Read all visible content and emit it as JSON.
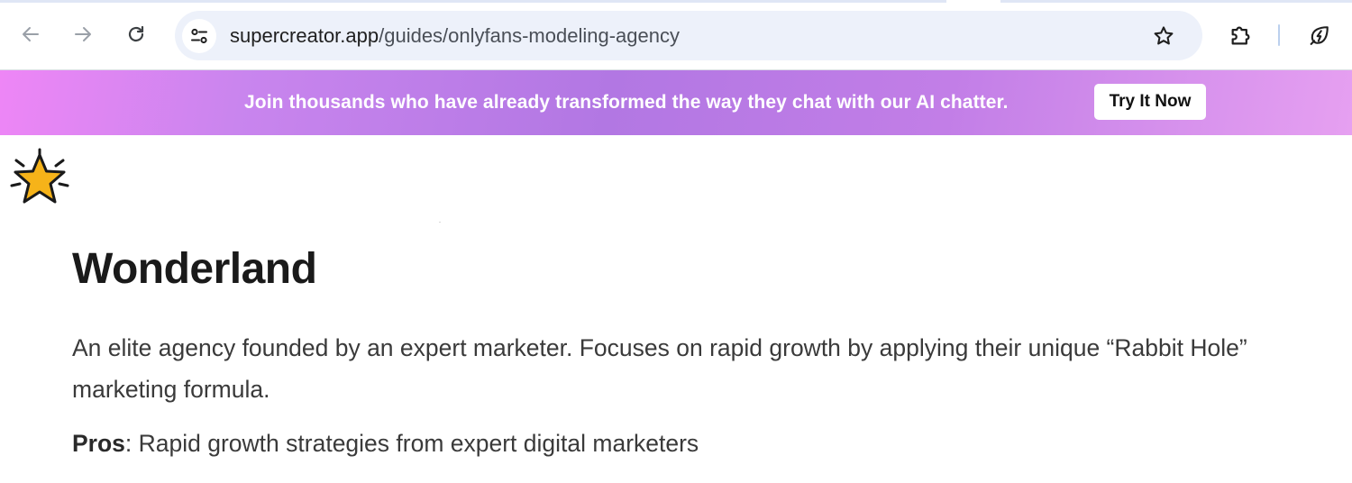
{
  "browser": {
    "url_host": "supercreator.app",
    "url_path": "/guides/onlyfans-modeling-agency",
    "icons": {
      "back": "back-arrow-icon",
      "forward": "forward-arrow-icon",
      "reload": "reload-icon",
      "site_info": "site-settings-icon",
      "bookmark": "star-icon",
      "extensions": "puzzle-icon",
      "performance": "leaf-bolt-icon"
    }
  },
  "banner": {
    "text": "Join thousands who have already transformed the way they chat with our AI chatter.",
    "cta_label": "Try It Now",
    "colors": {
      "start": "#ee86f6",
      "mid": "#b277e3",
      "end": "#e6a0f1"
    }
  },
  "content": {
    "logo_icon": "sparkle-star-icon",
    "title": "Wonderland",
    "description": "An elite agency founded by an expert marketer. Focuses on rapid growth by applying their unique “Rabbit Hole” marketing formula.",
    "pros_label": "Pros",
    "pros_text": ": Rapid growth strategies from expert digital marketers"
  }
}
